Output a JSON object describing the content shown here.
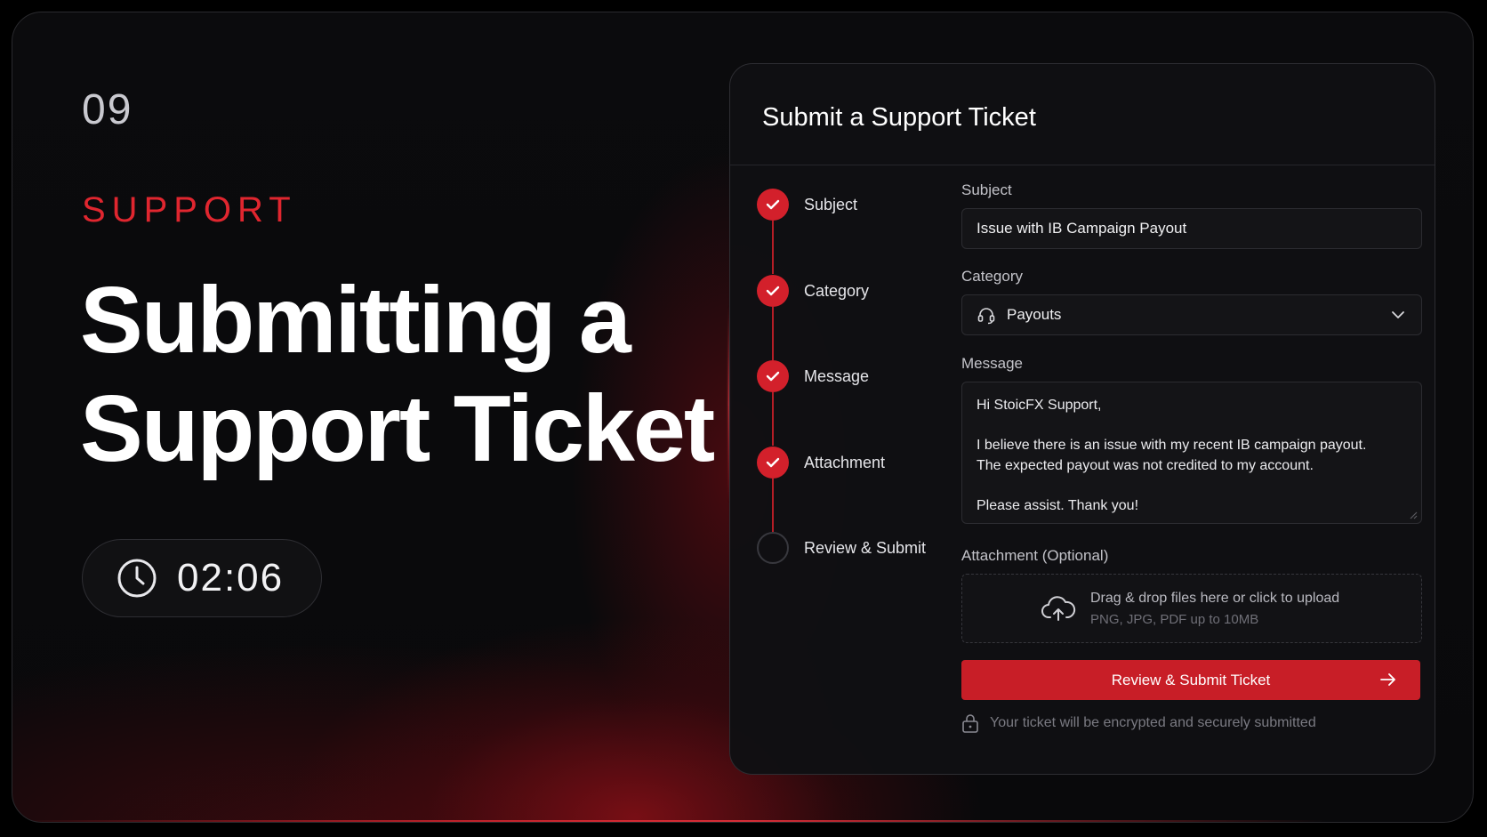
{
  "slide": {
    "number": "09",
    "eyebrow": "SUPPORT",
    "headline_line1": "Submitting a",
    "headline_line2": "Support Ticket",
    "timer": "02:06"
  },
  "card": {
    "title": "Submit a Support Ticket",
    "steps": [
      {
        "label": "Subject",
        "status": "done"
      },
      {
        "label": "Category",
        "status": "done"
      },
      {
        "label": "Message",
        "status": "done"
      },
      {
        "label": "Attachment",
        "status": "done"
      },
      {
        "label": "Review & Submit",
        "status": "pending"
      }
    ],
    "subject": {
      "label": "Subject",
      "value": "Issue with IB Campaign Payout"
    },
    "category": {
      "label": "Category",
      "value": "Payouts",
      "icon": "headset-icon"
    },
    "message": {
      "label": "Message",
      "line1": "Hi StoicFX Support,",
      "line2": "I believe there is an issue with my recent IB campaign payout.",
      "line3": "The expected payout was not credited to my account.",
      "line4": "Please assist. Thank you!"
    },
    "attachment": {
      "label": "Attachment (Optional)",
      "main": "Drag & drop files here or click to upload",
      "sub": "PNG, JPG, PDF up to 10MB"
    },
    "submit_label": "Review & Submit Ticket",
    "security_note": "Your ticket will be encrypted and securely submitted"
  },
  "colors": {
    "accent": "#d3202b",
    "background": "#0b0b0d",
    "card": "#101013"
  }
}
